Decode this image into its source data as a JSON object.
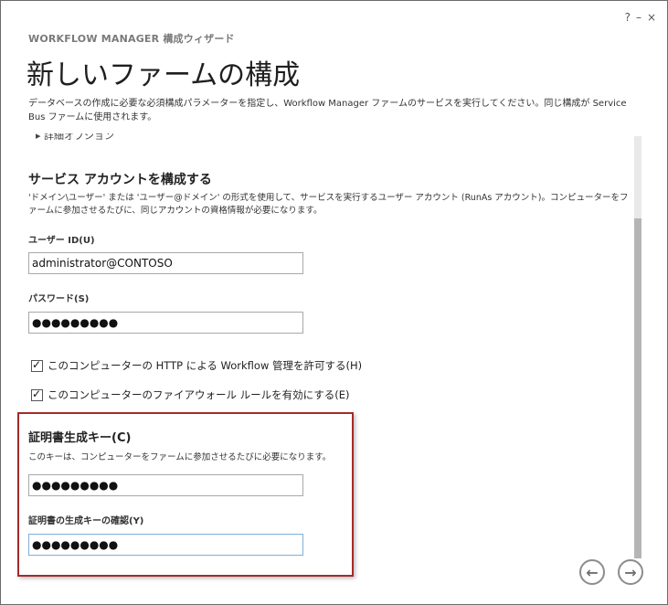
{
  "window": {
    "help_label": "?",
    "minimize_label": "–",
    "close_label": "×"
  },
  "app_title": "WORKFLOW MANAGER 構成ウィザード",
  "page_title": "新しいファームの構成",
  "description": "データベースの作成に必要な必須構成パラメーターを指定し、Workflow Manager ファームのサービスを実行してください。同じ構成が Service Bus ファームに使用されます。",
  "partial_option": "▸ 詳細オプション",
  "service_account": {
    "title": "サービス アカウントを構成する",
    "description": "'ドメイン\\ユーザー' または 'ユーザー@ドメイン' の形式を使用して、サービスを実行するユーザー アカウント (RunAs アカウント)。コンピューターをファームに参加させるたびに、同じアカウントの資格情報が必要になります。",
    "user_id_label": "ユーザー ID(U)",
    "user_id_value": "administrator@CONTOSO",
    "password_label": "パスワード(S)",
    "password_value": "●●●●●●●●●"
  },
  "checkboxes": [
    {
      "label": "このコンピューターの HTTP による Workflow 管理を許可する(H)",
      "checked": true,
      "tick": "✓"
    },
    {
      "label": "このコンピューターのファイアウォール ルールを有効にする(E)",
      "checked": true,
      "tick": "✓"
    }
  ],
  "certificate": {
    "title": "証明書生成キー(C)",
    "description": "このキーは、コンピューターをファームに参加させるたびに必要になります。",
    "key_value": "●●●●●●●●●",
    "confirm_label": "証明書の生成キーの確認(Y)",
    "confirm_value": "●●●●●●●●●"
  },
  "navigation": {
    "back_icon": "←",
    "next_icon": "→"
  },
  "colors": {
    "highlight_border": "#a52a2a",
    "title_gray": "#7a7a7a"
  }
}
